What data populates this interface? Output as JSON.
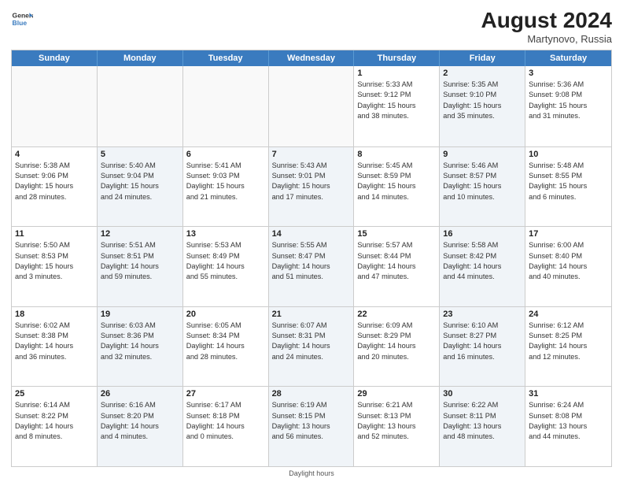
{
  "header": {
    "logo_general": "General",
    "logo_blue": "Blue",
    "month_year": "August 2024",
    "location": "Martynovo, Russia"
  },
  "weekdays": [
    "Sunday",
    "Monday",
    "Tuesday",
    "Wednesday",
    "Thursday",
    "Friday",
    "Saturday"
  ],
  "weeks": [
    [
      {
        "day": "",
        "info": "",
        "shaded": false,
        "empty": true
      },
      {
        "day": "",
        "info": "",
        "shaded": false,
        "empty": true
      },
      {
        "day": "",
        "info": "",
        "shaded": false,
        "empty": true
      },
      {
        "day": "",
        "info": "",
        "shaded": false,
        "empty": true
      },
      {
        "day": "1",
        "info": "Sunrise: 5:33 AM\nSunset: 9:12 PM\nDaylight: 15 hours\nand 38 minutes.",
        "shaded": false,
        "empty": false
      },
      {
        "day": "2",
        "info": "Sunrise: 5:35 AM\nSunset: 9:10 PM\nDaylight: 15 hours\nand 35 minutes.",
        "shaded": true,
        "empty": false
      },
      {
        "day": "3",
        "info": "Sunrise: 5:36 AM\nSunset: 9:08 PM\nDaylight: 15 hours\nand 31 minutes.",
        "shaded": false,
        "empty": false
      }
    ],
    [
      {
        "day": "4",
        "info": "Sunrise: 5:38 AM\nSunset: 9:06 PM\nDaylight: 15 hours\nand 28 minutes.",
        "shaded": false,
        "empty": false
      },
      {
        "day": "5",
        "info": "Sunrise: 5:40 AM\nSunset: 9:04 PM\nDaylight: 15 hours\nand 24 minutes.",
        "shaded": true,
        "empty": false
      },
      {
        "day": "6",
        "info": "Sunrise: 5:41 AM\nSunset: 9:03 PM\nDaylight: 15 hours\nand 21 minutes.",
        "shaded": false,
        "empty": false
      },
      {
        "day": "7",
        "info": "Sunrise: 5:43 AM\nSunset: 9:01 PM\nDaylight: 15 hours\nand 17 minutes.",
        "shaded": true,
        "empty": false
      },
      {
        "day": "8",
        "info": "Sunrise: 5:45 AM\nSunset: 8:59 PM\nDaylight: 15 hours\nand 14 minutes.",
        "shaded": false,
        "empty": false
      },
      {
        "day": "9",
        "info": "Sunrise: 5:46 AM\nSunset: 8:57 PM\nDaylight: 15 hours\nand 10 minutes.",
        "shaded": true,
        "empty": false
      },
      {
        "day": "10",
        "info": "Sunrise: 5:48 AM\nSunset: 8:55 PM\nDaylight: 15 hours\nand 6 minutes.",
        "shaded": false,
        "empty": false
      }
    ],
    [
      {
        "day": "11",
        "info": "Sunrise: 5:50 AM\nSunset: 8:53 PM\nDaylight: 15 hours\nand 3 minutes.",
        "shaded": false,
        "empty": false
      },
      {
        "day": "12",
        "info": "Sunrise: 5:51 AM\nSunset: 8:51 PM\nDaylight: 14 hours\nand 59 minutes.",
        "shaded": true,
        "empty": false
      },
      {
        "day": "13",
        "info": "Sunrise: 5:53 AM\nSunset: 8:49 PM\nDaylight: 14 hours\nand 55 minutes.",
        "shaded": false,
        "empty": false
      },
      {
        "day": "14",
        "info": "Sunrise: 5:55 AM\nSunset: 8:47 PM\nDaylight: 14 hours\nand 51 minutes.",
        "shaded": true,
        "empty": false
      },
      {
        "day": "15",
        "info": "Sunrise: 5:57 AM\nSunset: 8:44 PM\nDaylight: 14 hours\nand 47 minutes.",
        "shaded": false,
        "empty": false
      },
      {
        "day": "16",
        "info": "Sunrise: 5:58 AM\nSunset: 8:42 PM\nDaylight: 14 hours\nand 44 minutes.",
        "shaded": true,
        "empty": false
      },
      {
        "day": "17",
        "info": "Sunrise: 6:00 AM\nSunset: 8:40 PM\nDaylight: 14 hours\nand 40 minutes.",
        "shaded": false,
        "empty": false
      }
    ],
    [
      {
        "day": "18",
        "info": "Sunrise: 6:02 AM\nSunset: 8:38 PM\nDaylight: 14 hours\nand 36 minutes.",
        "shaded": false,
        "empty": false
      },
      {
        "day": "19",
        "info": "Sunrise: 6:03 AM\nSunset: 8:36 PM\nDaylight: 14 hours\nand 32 minutes.",
        "shaded": true,
        "empty": false
      },
      {
        "day": "20",
        "info": "Sunrise: 6:05 AM\nSunset: 8:34 PM\nDaylight: 14 hours\nand 28 minutes.",
        "shaded": false,
        "empty": false
      },
      {
        "day": "21",
        "info": "Sunrise: 6:07 AM\nSunset: 8:31 PM\nDaylight: 14 hours\nand 24 minutes.",
        "shaded": true,
        "empty": false
      },
      {
        "day": "22",
        "info": "Sunrise: 6:09 AM\nSunset: 8:29 PM\nDaylight: 14 hours\nand 20 minutes.",
        "shaded": false,
        "empty": false
      },
      {
        "day": "23",
        "info": "Sunrise: 6:10 AM\nSunset: 8:27 PM\nDaylight: 14 hours\nand 16 minutes.",
        "shaded": true,
        "empty": false
      },
      {
        "day": "24",
        "info": "Sunrise: 6:12 AM\nSunset: 8:25 PM\nDaylight: 14 hours\nand 12 minutes.",
        "shaded": false,
        "empty": false
      }
    ],
    [
      {
        "day": "25",
        "info": "Sunrise: 6:14 AM\nSunset: 8:22 PM\nDaylight: 14 hours\nand 8 minutes.",
        "shaded": false,
        "empty": false
      },
      {
        "day": "26",
        "info": "Sunrise: 6:16 AM\nSunset: 8:20 PM\nDaylight: 14 hours\nand 4 minutes.",
        "shaded": true,
        "empty": false
      },
      {
        "day": "27",
        "info": "Sunrise: 6:17 AM\nSunset: 8:18 PM\nDaylight: 14 hours\nand 0 minutes.",
        "shaded": false,
        "empty": false
      },
      {
        "day": "28",
        "info": "Sunrise: 6:19 AM\nSunset: 8:15 PM\nDaylight: 13 hours\nand 56 minutes.",
        "shaded": true,
        "empty": false
      },
      {
        "day": "29",
        "info": "Sunrise: 6:21 AM\nSunset: 8:13 PM\nDaylight: 13 hours\nand 52 minutes.",
        "shaded": false,
        "empty": false
      },
      {
        "day": "30",
        "info": "Sunrise: 6:22 AM\nSunset: 8:11 PM\nDaylight: 13 hours\nand 48 minutes.",
        "shaded": true,
        "empty": false
      },
      {
        "day": "31",
        "info": "Sunrise: 6:24 AM\nSunset: 8:08 PM\nDaylight: 13 hours\nand 44 minutes.",
        "shaded": false,
        "empty": false
      }
    ]
  ],
  "footer": "Daylight hours"
}
